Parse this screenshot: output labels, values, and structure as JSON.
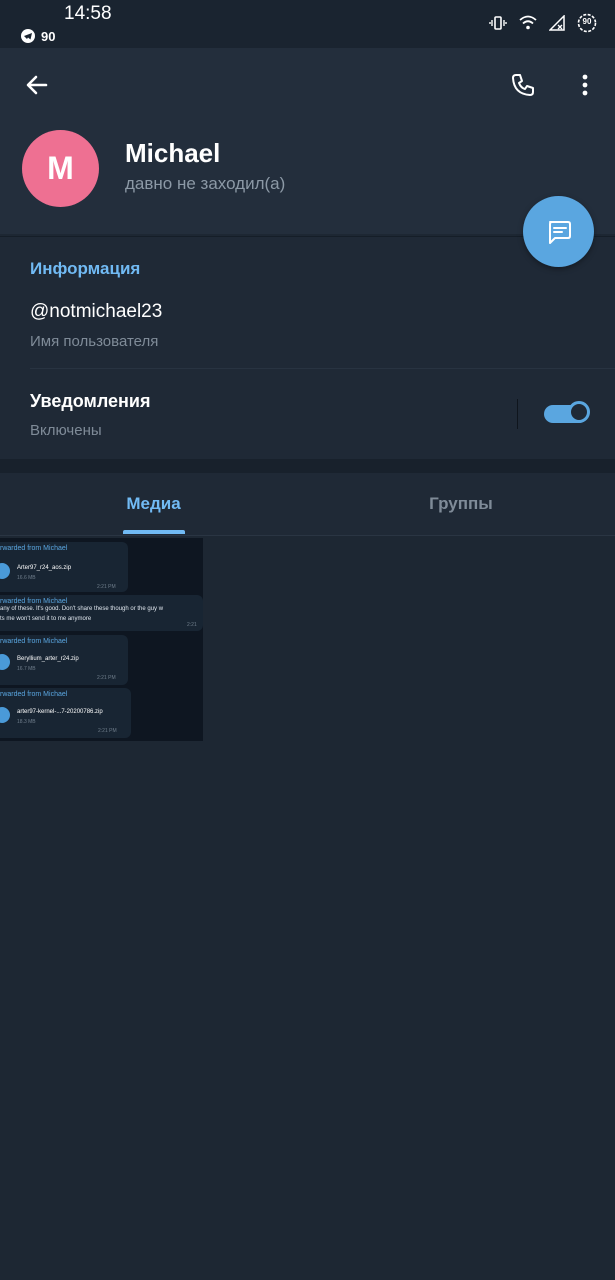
{
  "status_bar": {
    "time": "14:58",
    "notification_count": "90",
    "battery_level": "90",
    "icons": [
      "telegram-icon",
      "vibrate-icon",
      "wifi-icon",
      "signal-icon",
      "battery-icon"
    ]
  },
  "toolbar": {
    "back_icon": "arrow-left-icon",
    "call_icon": "phone-icon",
    "more_icon": "more-vertical-icon"
  },
  "profile": {
    "avatar_letter": "M",
    "avatar_color": "#ee7092",
    "name": "Michael",
    "status": "давно не заходил(а)"
  },
  "fab": {
    "icon": "message-icon"
  },
  "info": {
    "title": "Информация",
    "username": "@notmichael23",
    "username_label": "Имя пользователя",
    "notifications_title": "Уведомления",
    "notifications_value": "Включены",
    "notifications_enabled": true
  },
  "tabs": [
    {
      "label": "Медиа",
      "active": true
    },
    {
      "label": "Группы",
      "active": false
    }
  ],
  "media_preview": {
    "messages": [
      {
        "fwd": "rwarded from Michael",
        "file_name": "Arter97_r24_aos.zip",
        "file_size": "16.6 MB",
        "time": "2:21 PM"
      },
      {
        "fwd": "rwarded from Michael",
        "text_line1": "any of these. It's good. Don't share these though or the guy w",
        "text_line2": "ts me won't send it to me anymore",
        "time": "2:21"
      },
      {
        "fwd": "rwarded from Michael",
        "file_name": "Beryllium_arter_r24.zip",
        "file_size": "16.7 MB",
        "time": "2:21 PM"
      },
      {
        "fwd": "rwarded from Michael",
        "file_name": "arter97-kernel-...7-20200786.zip",
        "file_size": "18.3 MB",
        "time": "2:21 PM"
      }
    ]
  },
  "colors": {
    "accent": "#5aa6e0",
    "link": "#71baf4",
    "background": "#1d2733",
    "header": "#232e3c"
  }
}
